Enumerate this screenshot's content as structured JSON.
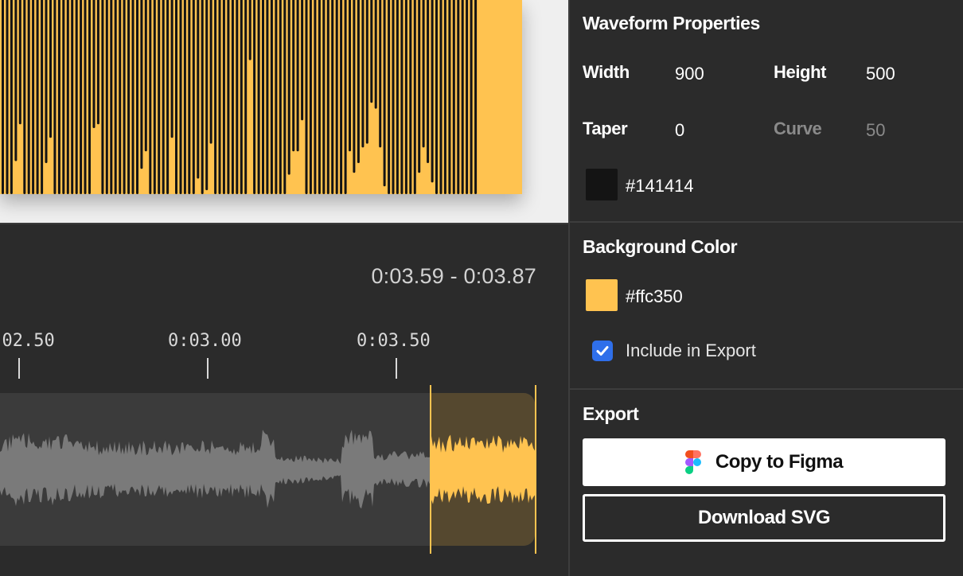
{
  "preview": {
    "bar_color": "#141414",
    "background_color": "#ffc350",
    "bar_levels": [
      1,
      1,
      1,
      0.83,
      0.64,
      1,
      1,
      1,
      1,
      1,
      0.84,
      0.71,
      1,
      1,
      1,
      1,
      1,
      1,
      1,
      1,
      1,
      0.66,
      0.64,
      1,
      1,
      1,
      1,
      1,
      1,
      1,
      1,
      1,
      0.87,
      0.78,
      1,
      1,
      1,
      1,
      1,
      0.71,
      1,
      1,
      1,
      1,
      1,
      0.92,
      1,
      0.98,
      0.74,
      1,
      1,
      1,
      1,
      1,
      1,
      1,
      1,
      0.31,
      1,
      1,
      1,
      1,
      1,
      1,
      1,
      1,
      0.9,
      0.78,
      0.78,
      0.62,
      1,
      1,
      1,
      1,
      1,
      1,
      1,
      1,
      1,
      1,
      0.78,
      0.89,
      0.84,
      0.76,
      0.74,
      0.53,
      0.56,
      0.76,
      0.96,
      1,
      1,
      1,
      1,
      1,
      1,
      1,
      0.89,
      0.76,
      0.84,
      0.94,
      1,
      1,
      1,
      1,
      1,
      1,
      1,
      1,
      1,
      1
    ]
  },
  "timeline": {
    "range_text": "0:03.59 - 0:03.87",
    "ticks": [
      {
        "label": "0:02.50"
      },
      {
        "label": "0:03.00"
      },
      {
        "label": "0:03.50"
      }
    ],
    "selection_color": "#ffc350",
    "wave_color": "#7a7a7a"
  },
  "panel": {
    "waveform": {
      "title": "Waveform Properties",
      "width_label": "Width",
      "width_value": "900",
      "height_label": "Height",
      "height_value": "500",
      "taper_label": "Taper",
      "taper_value": "0",
      "curve_label": "Curve",
      "curve_value": "50",
      "color_hex": "#141414"
    },
    "background": {
      "title": "Background Color",
      "color_hex": "#ffc350",
      "include_label": "Include in Export",
      "include_checked": true
    },
    "export": {
      "title": "Export",
      "figma_label": "Copy to Figma",
      "svg_label": "Download SVG"
    }
  }
}
